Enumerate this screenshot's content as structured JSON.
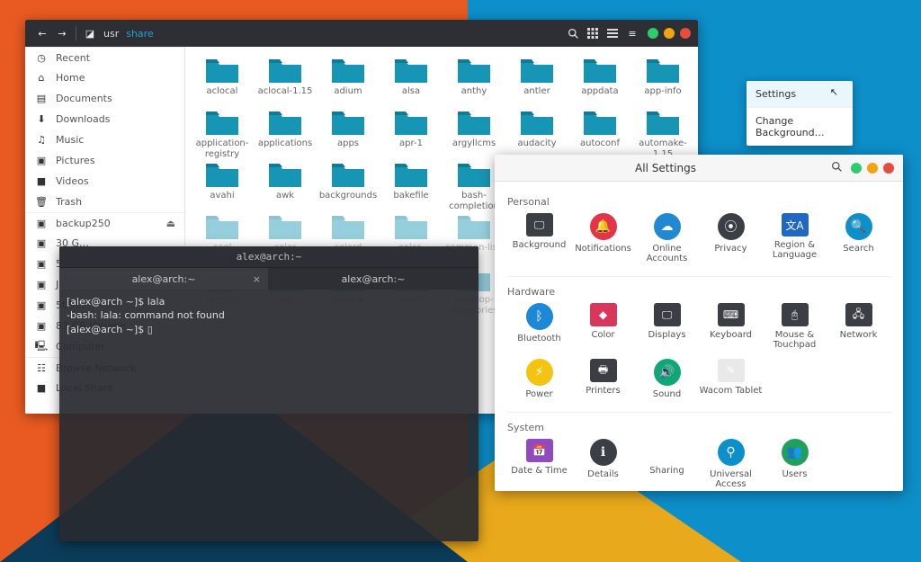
{
  "filemanager": {
    "path": {
      "root": "usr",
      "current": "share"
    },
    "toolbar": {
      "back": "←",
      "forward": "→",
      "disk": "⌂"
    },
    "sidebar": {
      "places": [
        "Recent",
        "Home",
        "Documents",
        "Downloads",
        "Music",
        "Pictures",
        "Videos",
        "Trash"
      ],
      "devices": [
        "backup250",
        "30 G…",
        "524…",
        "J. C…",
        "500…",
        "87 GB Volume",
        "Computer"
      ],
      "network": [
        "Browse Network",
        "Local Share"
      ]
    },
    "folders_row1": [
      "aclocal",
      "aclocal-1.15",
      "adium",
      "alsa",
      "anthy",
      "antler",
      "appdata",
      "app-info"
    ],
    "folders_row2": [
      "application-registry",
      "applications",
      "apps",
      "apr-1",
      "argyllcms",
      "audacity",
      "autoconf",
      "automake-1.15"
    ],
    "folders_row3": [
      "avahi",
      "awk",
      "backgrounds",
      "bakefile",
      "bash-completion"
    ],
    "folders_row4": [
      "cogl",
      "color",
      "colord",
      "color-schemes",
      "common-lisp"
    ],
    "folders_row5": [
      "cryptui",
      "cvs",
      "dbus-1",
      "dconf",
      "desktop-directories"
    ]
  },
  "terminal": {
    "title": "alex@arch:~",
    "tabs": [
      "alex@arch:~",
      "alex@arch:~"
    ],
    "lines": "[alex@arch ~]$ lala\n-bash: lala: command not found\n[alex@arch ~]$ ▯"
  },
  "settings": {
    "title": "All Settings",
    "sections": {
      "personal": {
        "label": "Personal",
        "items": [
          "Background",
          "Notifications",
          "Online Accounts",
          "Privacy",
          "Region & Language",
          "Search"
        ]
      },
      "hardware": {
        "label": "Hardware",
        "items": [
          "Bluetooth",
          "Color",
          "Displays",
          "Keyboard",
          "Mouse & Touchpad",
          "Network",
          "Power",
          "Printers",
          "Sound",
          "Wacom Tablet"
        ]
      },
      "system": {
        "label": "System",
        "items": [
          "Date & Time",
          "Details",
          "Sharing",
          "Universal Access",
          "Users"
        ]
      }
    }
  },
  "contextmenu": {
    "settings": "Settings",
    "change_bg": "Change Background…"
  },
  "colors": {
    "folder": "#1795b4",
    "accent_blue": "#0d8fc9",
    "icon_colors": {
      "background": "#3b3e45",
      "notifications": "#e3354a",
      "online": "#2089d2",
      "privacy": "#3b3e45",
      "region": "#2067c4",
      "search": "#0d8fc9",
      "bluetooth": "#1c88d6",
      "color": "#d8375b",
      "displays": "#3b3e45",
      "keyboard": "#3b3e45",
      "mouse": "#3b3e45",
      "network": "#3b3e45",
      "power": "#f4c413",
      "printers": "#3b3e45",
      "sound": "#0fa874",
      "wacom": "#e4e4e4",
      "date": "#8f4bbf",
      "details": "#3b3e45",
      "sharing": "#3b3e45",
      "ua": "#0d8fc9",
      "users": "#1fa15d"
    }
  }
}
